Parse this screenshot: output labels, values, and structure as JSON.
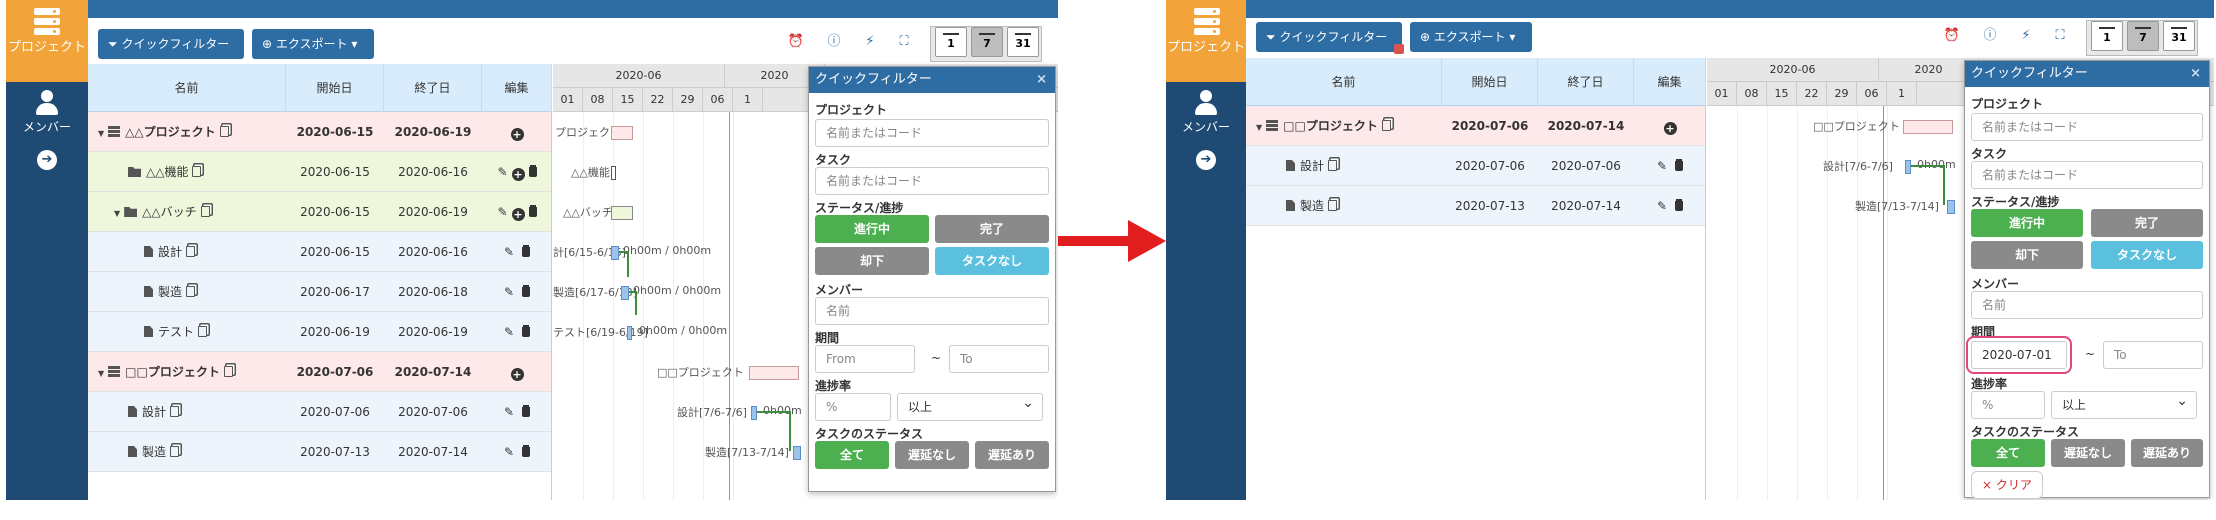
{
  "sidebar": {
    "project_label": "プロジェクト",
    "member_label": "メンバー"
  },
  "toolbar": {
    "quick_filter": "クイックフィルター",
    "export": "エクスポート",
    "cal_day": "1",
    "cal_week": "7",
    "cal_month": "31"
  },
  "grid": {
    "headers": {
      "name": "名前",
      "start": "開始日",
      "end": "終了日",
      "edit": "編集"
    }
  },
  "left": {
    "gantt_months": [
      "2020-06",
      "2020"
    ],
    "gantt_days": [
      "01",
      "08",
      "15",
      "22",
      "29",
      "06",
      "1"
    ],
    "rows": [
      {
        "name": "△△プロジェクト",
        "start": "2020-06-15",
        "end": "2020-06-19"
      },
      {
        "name": "△△機能",
        "start": "2020-06-15",
        "end": "2020-06-16"
      },
      {
        "name": "△△バッチ",
        "start": "2020-06-15",
        "end": "2020-06-19"
      },
      {
        "name": "設計",
        "start": "2020-06-15",
        "end": "2020-06-16"
      },
      {
        "name": "製造",
        "start": "2020-06-17",
        "end": "2020-06-18"
      },
      {
        "name": "テスト",
        "start": "2020-06-19",
        "end": "2020-06-19"
      },
      {
        "name": "□□プロジェクト",
        "start": "2020-07-06",
        "end": "2020-07-14"
      },
      {
        "name": "設計",
        "start": "2020-07-06",
        "end": "2020-07-06"
      },
      {
        "name": "製造",
        "start": "2020-07-13",
        "end": "2020-07-14"
      }
    ],
    "gantt_labels": {
      "p1": "プロジェクト",
      "f1": "△△機能",
      "b1": "△△バッチ",
      "d1": "計[6/15-6/16]",
      "d1t": "0h00m / 0h00m",
      "m1": "製造[6/17-6/18]",
      "m1t": "0h00m / 0h00m",
      "t1": "テスト[6/19-6/19]",
      "t1t": "0h00m / 0h00m",
      "p2": "□□プロジェクト",
      "d2": "設計[7/6-7/6]",
      "d2t": "0h00m",
      "m2": "製造[7/13-7/14]"
    }
  },
  "right": {
    "gantt_months": [
      "2020-06",
      "2020"
    ],
    "gantt_days": [
      "01",
      "08",
      "15",
      "22",
      "29",
      "06",
      "1"
    ],
    "rows": [
      {
        "name": "□□プロジェクト",
        "start": "2020-07-06",
        "end": "2020-07-14"
      },
      {
        "name": "設計",
        "start": "2020-07-06",
        "end": "2020-07-06"
      },
      {
        "name": "製造",
        "start": "2020-07-13",
        "end": "2020-07-14"
      }
    ],
    "gantt_labels": {
      "p2": "□□プロジェクト",
      "d2": "設計[7/6-7/6]",
      "d2t": "0h00m",
      "m2": "製造[7/13-7/14]"
    }
  },
  "filter": {
    "title": "クイックフィルター",
    "close": "×",
    "project_label": "プロジェクト",
    "project_placeholder": "名前またはコード",
    "task_label": "タスク",
    "task_placeholder": "名前またはコード",
    "status_label": "ステータス/進捗",
    "status_in_progress": "進行中",
    "status_done": "完了",
    "status_rejected": "却下",
    "status_no_task": "タスクなし",
    "member_label": "メンバー",
    "member_placeholder": "名前",
    "period_label": "期間",
    "from_placeholder": "From",
    "to_placeholder": "To",
    "tilde": "~",
    "progress_label": "進捗率",
    "progress_placeholder": "%",
    "progress_op": "以上",
    "task_status_label": "タスクのステータス",
    "ts_all": "全て",
    "ts_no_delay": "遅延なし",
    "ts_delay": "遅延あり",
    "from_value_right": "2020-07-01",
    "clear": "× クリア"
  }
}
